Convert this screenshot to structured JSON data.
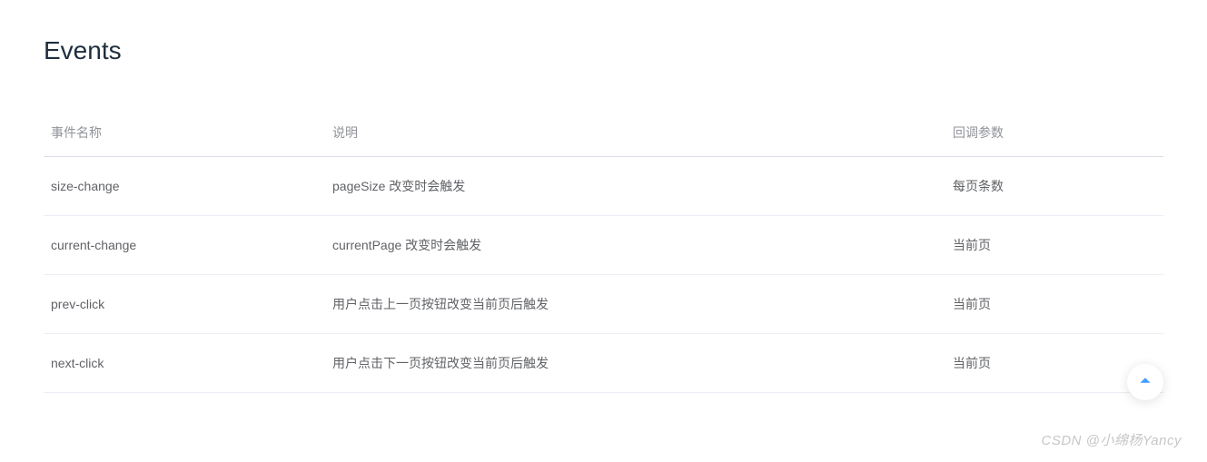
{
  "heading": "Events",
  "table": {
    "headers": {
      "name": "事件名称",
      "description": "说明",
      "callback": "回调参数"
    },
    "rows": [
      {
        "name": "size-change",
        "description": "pageSize 改变时会触发",
        "callback": "每页条数"
      },
      {
        "name": "current-change",
        "description": "currentPage 改变时会触发",
        "callback": "当前页"
      },
      {
        "name": "prev-click",
        "description": "用户点击上一页按钮改变当前页后触发",
        "callback": "当前页"
      },
      {
        "name": "next-click",
        "description": "用户点击下一页按钮改变当前页后触发",
        "callback": "当前页"
      }
    ]
  },
  "watermark": "CSDN @小绵杨Yancy"
}
